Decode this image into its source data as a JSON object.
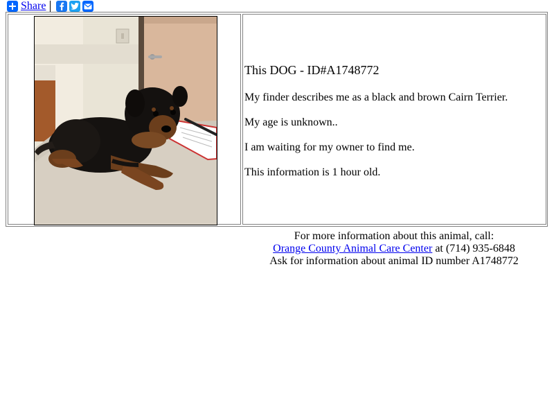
{
  "share_bar": {
    "share_label": "Share",
    "icons": [
      "plus-icon",
      "facebook-icon",
      "twitter-icon",
      "email-icon"
    ],
    "colors": {
      "share": "#0166ff",
      "facebook": "#1877f2",
      "twitter": "#1da1f2",
      "email": "#0166ff"
    }
  },
  "animal": {
    "title": "This DOG - ID#A1748772",
    "line1": "My finder describes me as a black and brown Cairn Terrier.",
    "line2": "My age is unknown..",
    "line3": "I am waiting for my owner to find me.",
    "line4": "This information is 1 hour old."
  },
  "contact": {
    "intro": "For more information about this animal, call:",
    "center_name": "Orange County Animal Care Center",
    "phone_text": " at (714) 935-6848",
    "ask_text": "Ask for information about animal ID number A1748772"
  },
  "link_color": "#0000ee"
}
